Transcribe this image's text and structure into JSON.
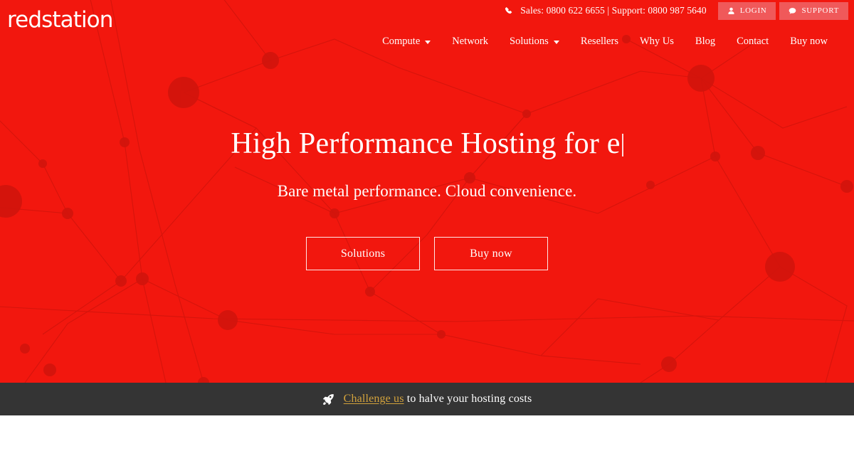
{
  "brand": {
    "logo_text": "redstation"
  },
  "topbar": {
    "phone_icon": "phone-icon",
    "contact_text": "Sales: 0800 622 6655 | Support: 0800 987 5640",
    "buttons": [
      {
        "label": "LOGIN",
        "icon": "user-icon"
      },
      {
        "label": "SUPPORT",
        "icon": "chat-bubble-icon"
      }
    ]
  },
  "nav": {
    "items": [
      {
        "label": "Compute",
        "has_dropdown": true
      },
      {
        "label": "Network",
        "has_dropdown": false
      },
      {
        "label": "Solutions",
        "has_dropdown": true
      },
      {
        "label": "Resellers",
        "has_dropdown": false
      },
      {
        "label": "Why Us",
        "has_dropdown": false
      },
      {
        "label": "Blog",
        "has_dropdown": false
      },
      {
        "label": "Contact",
        "has_dropdown": false
      },
      {
        "label": "Buy now",
        "has_dropdown": false
      }
    ]
  },
  "hero": {
    "headline_static": "High Performance Hosting for",
    "headline_typed": "e",
    "subheadline": "Bare metal performance. Cloud convenience.",
    "cta": [
      {
        "label": "Solutions"
      },
      {
        "label": "Buy now"
      }
    ]
  },
  "banner": {
    "icon": "rocket-icon",
    "link_text": "Challenge us",
    "text_after": " to halve your hosting costs"
  },
  "colors": {
    "brand_red": "#f2170e",
    "topbutton_red": "#f0595a",
    "banner_dark": "#343434",
    "banner_link_gold": "#d2a23c",
    "text_white": "#ffffff"
  }
}
